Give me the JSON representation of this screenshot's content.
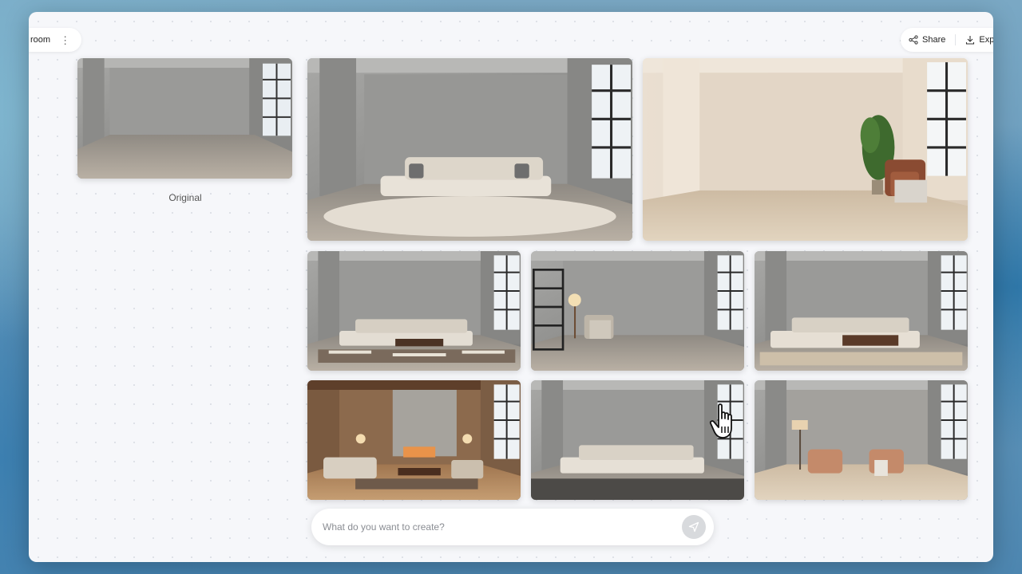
{
  "header": {
    "title": "room",
    "menu_icon": "more-vertical-icon"
  },
  "actions": {
    "share_label": "Share",
    "export_label": "Expor",
    "share_icon": "share-icon",
    "export_icon": "download-icon"
  },
  "original": {
    "caption": "Original"
  },
  "prompt": {
    "placeholder": "What do you want to create?",
    "send_icon": "send-icon"
  },
  "colors": {
    "window_bg": "#f6f7fa",
    "concrete_wall": "#9a9a9a",
    "beige_wall": "#e3d7c8",
    "wood_floor": "#b08862",
    "send_button": "#d8dadd"
  }
}
